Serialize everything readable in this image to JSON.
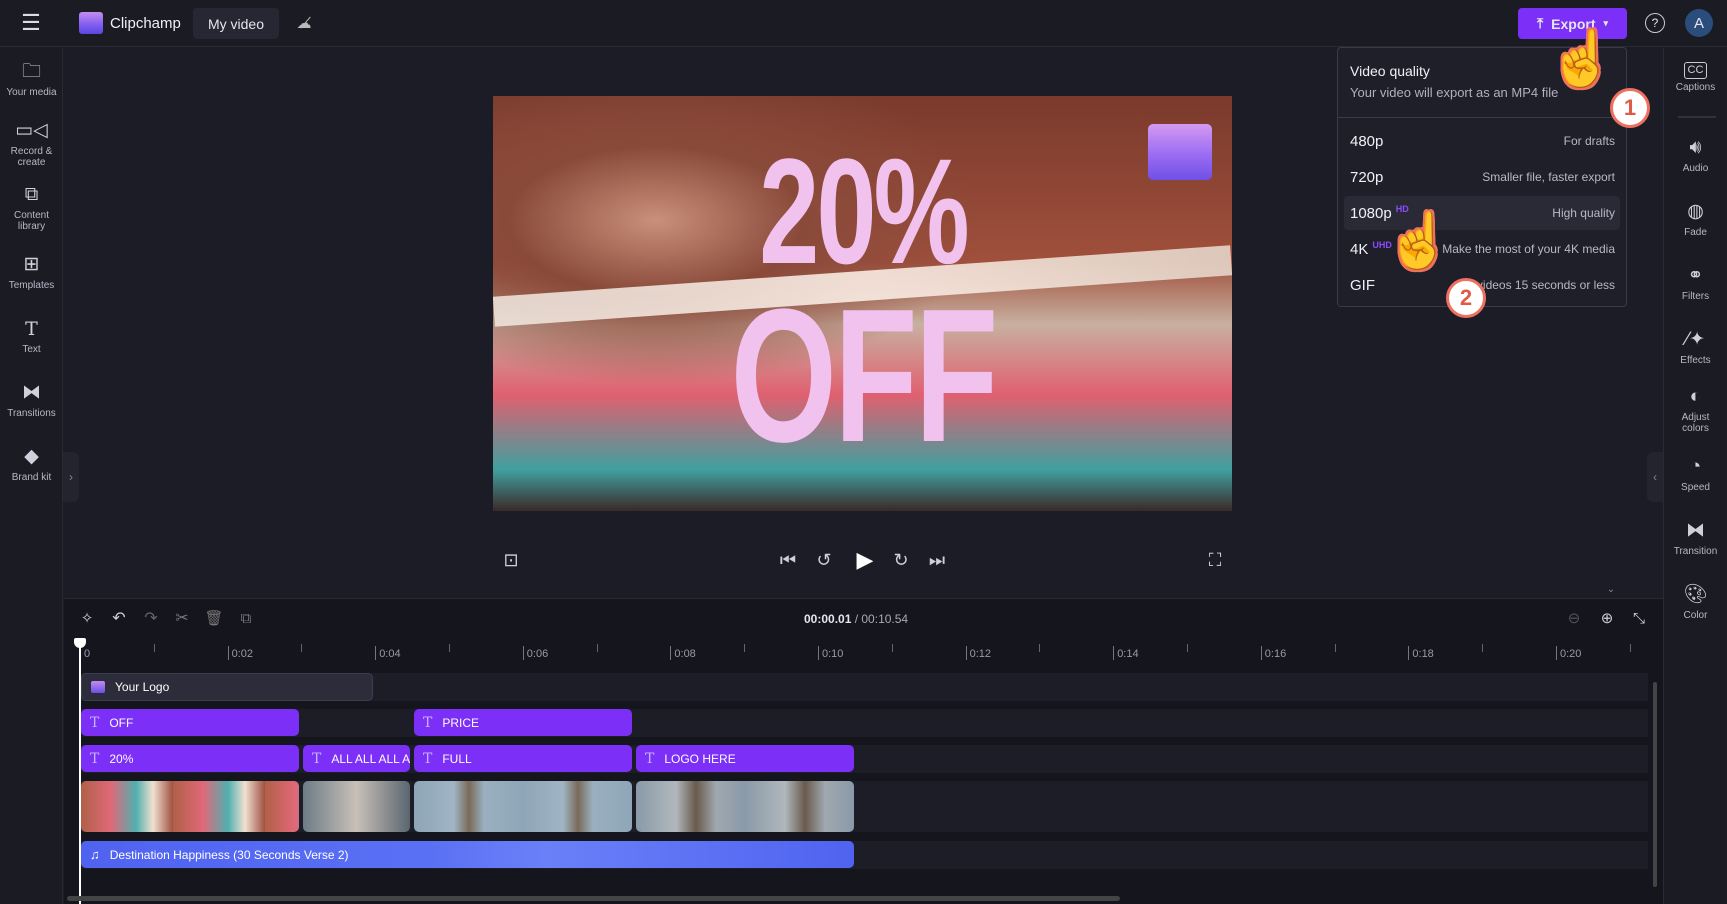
{
  "topbar": {
    "app_name": "Clipchamp",
    "project_title": "My video",
    "export_label": "Export",
    "avatar_initial": "A"
  },
  "left_sidebar": {
    "items": [
      {
        "label": "Your media",
        "icon": "folder-icon"
      },
      {
        "label": "Record & create",
        "icon": "camera-icon"
      },
      {
        "label": "Content library",
        "icon": "library-icon"
      },
      {
        "label": "Templates",
        "icon": "templates-icon"
      },
      {
        "label": "Text",
        "icon": "text-icon"
      },
      {
        "label": "Transitions",
        "icon": "transitions-icon"
      },
      {
        "label": "Brand kit",
        "icon": "brand-kit-icon"
      }
    ]
  },
  "right_sidebar": {
    "items": [
      {
        "label": "Captions",
        "icon": "cc-icon"
      },
      {
        "label": "Audio",
        "icon": "speaker-icon"
      },
      {
        "label": "Fade",
        "icon": "fade-icon"
      },
      {
        "label": "Filters",
        "icon": "filters-icon"
      },
      {
        "label": "Effects",
        "icon": "magic-wand-icon"
      },
      {
        "label": "Adjust colors",
        "icon": "contrast-icon"
      },
      {
        "label": "Speed",
        "icon": "speedometer-icon"
      },
      {
        "label": "Transition",
        "icon": "transition-icon"
      },
      {
        "label": "Color",
        "icon": "palette-icon"
      }
    ]
  },
  "preview": {
    "promo_line1": "20%",
    "promo_line2": "OFF"
  },
  "export_menu": {
    "title": "Video quality",
    "subtitle": "Your video will export as an MP4 file",
    "options": [
      {
        "quality": "480p",
        "badge": "",
        "desc": "For drafts"
      },
      {
        "quality": "720p",
        "badge": "",
        "desc": "Smaller file, faster export"
      },
      {
        "quality": "1080p",
        "badge": "HD",
        "desc": "High quality",
        "highlighted": true
      },
      {
        "quality": "4K",
        "badge": "UHD",
        "desc": "Make the most of your 4K media"
      },
      {
        "quality": "GIF",
        "badge": "",
        "desc": "For videos 15 seconds or less"
      }
    ]
  },
  "annotations": {
    "step1": "1",
    "step2": "2"
  },
  "timeline": {
    "current_time": "00:00.01",
    "total_time": "/ 00:10.54",
    "ticks": [
      "0",
      "0:02",
      "0:04",
      "0:06",
      "0:08",
      "0:10",
      "0:12",
      "0:14",
      "0:16",
      "0:18",
      "0:20"
    ],
    "logo_clip": "Your Logo",
    "text_row1": [
      "OFF",
      "PRICE"
    ],
    "text_row2": [
      "20%",
      "ALL ALL ALL A",
      "FULL",
      "LOGO HERE"
    ],
    "audio_clip": "Destination Happiness (30 Seconds Verse 2)"
  },
  "colors": {
    "accent": "#7b2ff7",
    "audio": "#4f63f0",
    "background": "#1c1c26"
  }
}
